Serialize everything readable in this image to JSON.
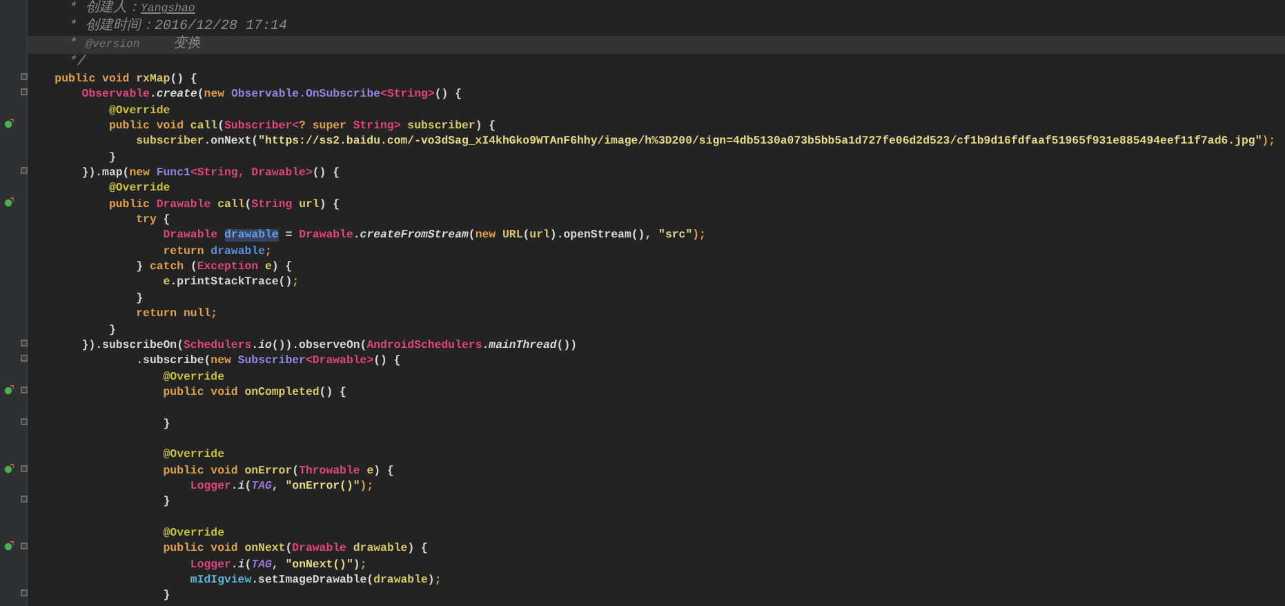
{
  "editor": {
    "lines": [
      {
        "current": false,
        "fold": false,
        "tokens": [
          {
            "kind": "comment",
            "text": "     * 创建人："
          },
          {
            "kind": "comment-link",
            "text": "Yangshao"
          }
        ]
      },
      {
        "current": false,
        "fold": false,
        "tokens": [
          {
            "kind": "comment",
            "text": "     * 创建时间：2016/12/28 17:14"
          }
        ]
      },
      {
        "current": true,
        "fold": false,
        "tokens": [
          {
            "kind": "comment",
            "text": "     * "
          },
          {
            "kind": "doc-tag",
            "text": "@version"
          },
          {
            "kind": "comment",
            "text": "    变换"
          }
        ]
      },
      {
        "current": false,
        "fold": false,
        "tokens": [
          {
            "kind": "comment",
            "text": "     */"
          }
        ]
      },
      {
        "current": false,
        "fold": true,
        "tokens": [
          {
            "kind": "kw",
            "text": "    public void "
          },
          {
            "kind": "method",
            "text": "rxMap"
          },
          {
            "kind": "plain",
            "text": "() {"
          }
        ]
      },
      {
        "current": false,
        "fold": true,
        "tokens": [
          {
            "kind": "cls",
            "text": "        Observable"
          },
          {
            "kind": "plain",
            "text": "."
          },
          {
            "kind": "static",
            "text": "create"
          },
          {
            "kind": "plain",
            "text": "("
          },
          {
            "kind": "kw",
            "text": "new "
          },
          {
            "kind": "iface",
            "text": "Observable.OnSubscribe"
          },
          {
            "kind": "cls",
            "text": "<String>"
          },
          {
            "kind": "plain",
            "text": "() {"
          }
        ]
      },
      {
        "current": false,
        "fold": false,
        "tokens": [
          {
            "kind": "ann",
            "text": "            @Override"
          }
        ]
      },
      {
        "current": false,
        "fold": false,
        "marker": true,
        "tokens": [
          {
            "kind": "kw",
            "text": "            public void "
          },
          {
            "kind": "method",
            "text": "call"
          },
          {
            "kind": "plain",
            "text": "("
          },
          {
            "kind": "cls",
            "text": "Subscriber<"
          },
          {
            "kind": "kw",
            "text": "? super "
          },
          {
            "kind": "cls",
            "text": "String> "
          },
          {
            "kind": "method",
            "text": "subscriber"
          },
          {
            "kind": "plain",
            "text": ") {"
          }
        ]
      },
      {
        "current": false,
        "fold": false,
        "tokens": [
          {
            "kind": "method",
            "text": "                subscriber"
          },
          {
            "kind": "plain",
            "text": ".onNext("
          },
          {
            "kind": "str",
            "text": "\"https://ss2.baidu.com/-vo3dSag_xI4khGko9WTAnF6hhy/image/h%3D200/sign=4db5130a073b5bb5a1d727fe06d2d523/cf1b9d16fdfaaf51965f931e885494eef11f7ad6.jpg\""
          },
          {
            "kind": "kw",
            "text": ");"
          }
        ]
      },
      {
        "current": false,
        "fold": false,
        "tokens": [
          {
            "kind": "plain",
            "text": "            }"
          }
        ]
      },
      {
        "current": false,
        "fold": true,
        "tokens": [
          {
            "kind": "plain",
            "text": "        }).map("
          },
          {
            "kind": "kw",
            "text": "new "
          },
          {
            "kind": "iface",
            "text": "Func1"
          },
          {
            "kind": "cls",
            "text": "<String, Drawable>"
          },
          {
            "kind": "plain",
            "text": "() {"
          }
        ]
      },
      {
        "current": false,
        "fold": false,
        "tokens": [
          {
            "kind": "ann",
            "text": "            @Override"
          }
        ]
      },
      {
        "current": false,
        "fold": false,
        "marker": true,
        "tokens": [
          {
            "kind": "kw",
            "text": "            public "
          },
          {
            "kind": "cls",
            "text": "Drawable "
          },
          {
            "kind": "method",
            "text": "call"
          },
          {
            "kind": "plain",
            "text": "("
          },
          {
            "kind": "cls",
            "text": "String "
          },
          {
            "kind": "method",
            "text": "url"
          },
          {
            "kind": "plain",
            "text": ") {"
          }
        ]
      },
      {
        "current": false,
        "fold": false,
        "tokens": [
          {
            "kind": "kw",
            "text": "                try "
          },
          {
            "kind": "plain",
            "text": "{"
          }
        ]
      },
      {
        "current": false,
        "fold": false,
        "tokens": [
          {
            "kind": "cls",
            "text": "                    Drawable "
          },
          {
            "kind": "selection",
            "text": "drawable"
          },
          {
            "kind": "plain",
            "text": " = "
          },
          {
            "kind": "cls",
            "text": "Drawable"
          },
          {
            "kind": "plain",
            "text": "."
          },
          {
            "kind": "static",
            "text": "createFromStream"
          },
          {
            "kind": "plain",
            "text": "("
          },
          {
            "kind": "kw",
            "text": "new "
          },
          {
            "kind": "method",
            "text": "URL"
          },
          {
            "kind": "plain",
            "text": "("
          },
          {
            "kind": "method",
            "text": "url"
          },
          {
            "kind": "plain",
            "text": ").openStream(), "
          },
          {
            "kind": "str",
            "text": "\"src\""
          },
          {
            "kind": "kw",
            "text": ");"
          }
        ]
      },
      {
        "current": false,
        "fold": false,
        "tokens": [
          {
            "kind": "kw",
            "text": "                    return "
          },
          {
            "kind": "local",
            "text": "drawable"
          },
          {
            "kind": "kw",
            "text": ";"
          }
        ]
      },
      {
        "current": false,
        "fold": false,
        "tokens": [
          {
            "kind": "plain",
            "text": "                } "
          },
          {
            "kind": "kw",
            "text": "catch "
          },
          {
            "kind": "plain",
            "text": "("
          },
          {
            "kind": "cls",
            "text": "Exception "
          },
          {
            "kind": "method",
            "text": "e"
          },
          {
            "kind": "plain",
            "text": ") {"
          }
        ]
      },
      {
        "current": false,
        "fold": false,
        "tokens": [
          {
            "kind": "method",
            "text": "                    e"
          },
          {
            "kind": "plain",
            "text": ".printStackTrace()"
          },
          {
            "kind": "kw",
            "text": ";"
          }
        ]
      },
      {
        "current": false,
        "fold": false,
        "tokens": [
          {
            "kind": "plain",
            "text": "                }"
          }
        ]
      },
      {
        "current": false,
        "fold": false,
        "tokens": [
          {
            "kind": "kw",
            "text": "                return null;"
          }
        ]
      },
      {
        "current": false,
        "fold": false,
        "tokens": [
          {
            "kind": "plain",
            "text": "            }"
          }
        ]
      },
      {
        "current": false,
        "fold": true,
        "tokens": [
          {
            "kind": "plain",
            "text": "        }).subscribeOn("
          },
          {
            "kind": "cls",
            "text": "Schedulers"
          },
          {
            "kind": "plain",
            "text": "."
          },
          {
            "kind": "static",
            "text": "io"
          },
          {
            "kind": "plain",
            "text": "()).observeOn("
          },
          {
            "kind": "cls",
            "text": "AndroidSchedulers"
          },
          {
            "kind": "plain",
            "text": "."
          },
          {
            "kind": "static",
            "text": "mainThread"
          },
          {
            "kind": "plain",
            "text": "())"
          }
        ]
      },
      {
        "current": false,
        "fold": true,
        "tokens": [
          {
            "kind": "plain",
            "text": "                .subscribe("
          },
          {
            "kind": "kw",
            "text": "new "
          },
          {
            "kind": "iface",
            "text": "Subscriber"
          },
          {
            "kind": "cls",
            "text": "<Drawable>"
          },
          {
            "kind": "plain",
            "text": "() {"
          }
        ]
      },
      {
        "current": false,
        "fold": false,
        "tokens": [
          {
            "kind": "ann",
            "text": "                    @Override"
          }
        ]
      },
      {
        "current": false,
        "fold": true,
        "marker": true,
        "tokens": [
          {
            "kind": "kw",
            "text": "                    public void "
          },
          {
            "kind": "method",
            "text": "onCompleted"
          },
          {
            "kind": "plain",
            "text": "() {"
          }
        ]
      },
      {
        "current": false,
        "fold": false
      },
      {
        "current": false,
        "fold": true,
        "tokens": [
          {
            "kind": "plain",
            "text": "                    }"
          }
        ]
      },
      {
        "current": false,
        "fold": false
      },
      {
        "current": false,
        "fold": false,
        "tokens": [
          {
            "kind": "ann",
            "text": "                    @Override"
          }
        ]
      },
      {
        "current": false,
        "fold": true,
        "marker": true,
        "tokens": [
          {
            "kind": "kw",
            "text": "                    public void "
          },
          {
            "kind": "method",
            "text": "onError"
          },
          {
            "kind": "plain",
            "text": "("
          },
          {
            "kind": "cls",
            "text": "Throwable "
          },
          {
            "kind": "method",
            "text": "e"
          },
          {
            "kind": "plain",
            "text": ") {"
          }
        ]
      },
      {
        "current": false,
        "fold": false,
        "tokens": [
          {
            "kind": "cls",
            "text": "                        Logger"
          },
          {
            "kind": "plain",
            "text": "."
          },
          {
            "kind": "static",
            "text": "i"
          },
          {
            "kind": "plain",
            "text": "("
          },
          {
            "kind": "const",
            "text": "TAG"
          },
          {
            "kind": "plain",
            "text": ", "
          },
          {
            "kind": "str",
            "text": "\"onError()\""
          },
          {
            "kind": "kw",
            "text": ");"
          }
        ]
      },
      {
        "current": false,
        "fold": true,
        "tokens": [
          {
            "kind": "plain",
            "text": "                    }"
          }
        ]
      },
      {
        "current": false,
        "fold": false
      },
      {
        "current": false,
        "fold": false,
        "tokens": [
          {
            "kind": "ann",
            "text": "                    @Override"
          }
        ]
      },
      {
        "current": false,
        "fold": true,
        "marker": true,
        "tokens": [
          {
            "kind": "kw",
            "text": "                    public void "
          },
          {
            "kind": "method",
            "text": "onNext"
          },
          {
            "kind": "plain",
            "text": "("
          },
          {
            "kind": "cls",
            "text": "Drawable "
          },
          {
            "kind": "method",
            "text": "drawable"
          },
          {
            "kind": "plain",
            "text": ") {"
          }
        ]
      },
      {
        "current": false,
        "fold": false,
        "tokens": [
          {
            "kind": "cls",
            "text": "                        Logger"
          },
          {
            "kind": "plain",
            "text": "."
          },
          {
            "kind": "static",
            "text": "i"
          },
          {
            "kind": "plain",
            "text": "("
          },
          {
            "kind": "const",
            "text": "TAG"
          },
          {
            "kind": "plain",
            "text": ", "
          },
          {
            "kind": "str",
            "text": "\"onNext()\""
          },
          {
            "kind": "plain",
            "text": ")"
          },
          {
            "kind": "kw",
            "text": ";"
          }
        ]
      },
      {
        "current": false,
        "fold": false,
        "tokens": [
          {
            "kind": "field",
            "text": "                        mIdIgview"
          },
          {
            "kind": "plain",
            "text": ".setImageDrawable("
          },
          {
            "kind": "method",
            "text": "drawable"
          },
          {
            "kind": "plain",
            "text": ")"
          },
          {
            "kind": "kw",
            "text": ";"
          }
        ]
      },
      {
        "current": false,
        "fold": true,
        "tokens": [
          {
            "kind": "plain",
            "text": "                    }"
          }
        ]
      }
    ]
  }
}
